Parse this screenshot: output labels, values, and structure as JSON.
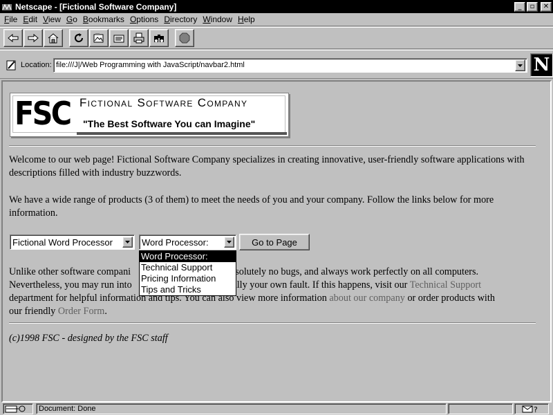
{
  "window": {
    "title": "Netscape - [Fictional Software Company]"
  },
  "menubar": {
    "items": [
      {
        "label": "File",
        "key": "F"
      },
      {
        "label": "Edit",
        "key": "E"
      },
      {
        "label": "View",
        "key": "V"
      },
      {
        "label": "Go",
        "key": "G"
      },
      {
        "label": "Bookmarks",
        "key": "B"
      },
      {
        "label": "Options",
        "key": "O"
      },
      {
        "label": "Directory",
        "key": "D"
      },
      {
        "label": "Window",
        "key": "W"
      },
      {
        "label": "Help",
        "key": "H"
      }
    ]
  },
  "toolbar": {
    "buttons": [
      "back-icon",
      "forward-icon",
      "home-icon",
      "reload-icon",
      "images-icon",
      "open-icon",
      "print-icon",
      "find-icon",
      "stop-icon"
    ]
  },
  "location": {
    "label": "Location:",
    "url": "file:///J|/Web Programming with JavaScript/navbar2.html"
  },
  "logo": {
    "letter": "N"
  },
  "banner": {
    "letters": "FSC",
    "company": "Fictional Software Company",
    "tagline": "\"The Best Software You can Imagine\""
  },
  "content": {
    "intro": "Welcome to our web page! Fictional Software Company specializes in creating innovative, user-friendly software applications with descriptions filled with industry buzzwords.",
    "products": "We have a wide range of products (3 of them) to meet the needs of you and your company. Follow the links below for more information.",
    "select1_value": "Fictional Word Processor",
    "select2_value": "Word Processor:",
    "go_button": "Go to Page",
    "dropdown_options": [
      "Word Processor:",
      "Technical Support",
      "Pricing Information",
      "Tips and Tricks"
    ],
    "body_part1": "Unlike other software compani",
    "body_part1b": "osolutely no bugs, and always work perfectly on all computers.",
    "body_part2": "Nevertheless, you may run into",
    "body_part2b": "usually your own fault. If this happens, visit our",
    "link_tech": "Technical Support",
    "body_part3": "department for helpful information and tips. You can also view more information",
    "link_about": "about our company",
    "body_part3b": "or order products with",
    "body_part4": "our friendly",
    "link_order": "Order Form",
    "period": ".",
    "footer": "(c)1998 FSC - designed by the FSC staff"
  },
  "status": {
    "text": "Document: Done"
  },
  "colors": {
    "chrome": "#c0c0c0",
    "link": "#606060",
    "titlebar": "#000000"
  }
}
